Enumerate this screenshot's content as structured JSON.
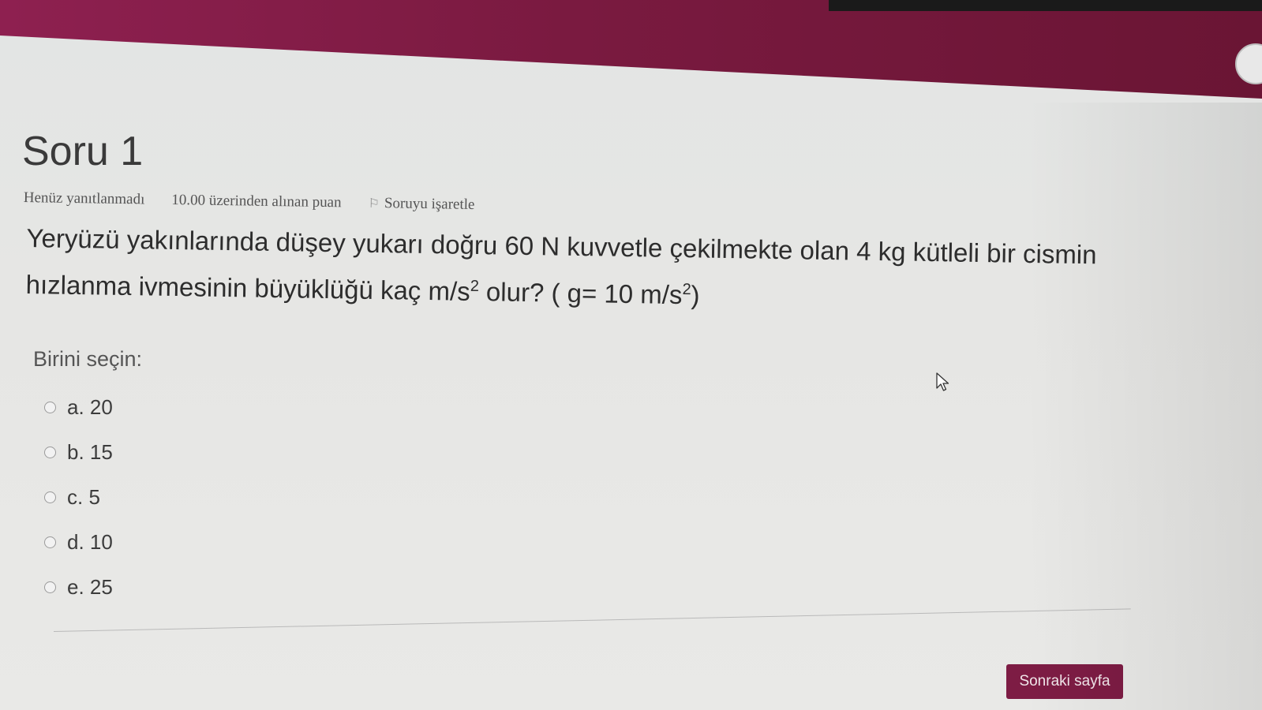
{
  "question": {
    "title": "Soru 1",
    "status": "Henüz yanıtlanmadı",
    "points": "10.00 üzerinden alınan puan",
    "flag_label": "Soruyu işaretle",
    "text_part1": "Yeryüzü yakınlarında düşey yukarı doğru 60 N kuvvetle çekilmekte olan 4 kg kütleli bir cismin hızlanma ivmesinin büyüklüğü kaç m/s",
    "text_sup1": "2",
    "text_part2": " olur? ( g= 10 m/s",
    "text_sup2": "2",
    "text_part3": ")"
  },
  "prompt": "Birini seçin:",
  "answers": [
    {
      "label": "a. 20"
    },
    {
      "label": "b. 15"
    },
    {
      "label": "c. 5"
    },
    {
      "label": "d. 10"
    },
    {
      "label": "e. 25"
    }
  ],
  "next_button": "Sonraki sayfa",
  "colors": {
    "brand": "#7d1c44",
    "page_bg": "#e3e5e4"
  },
  "icons": [
    "flag-icon",
    "avatar",
    "mouse-cursor-icon"
  ]
}
